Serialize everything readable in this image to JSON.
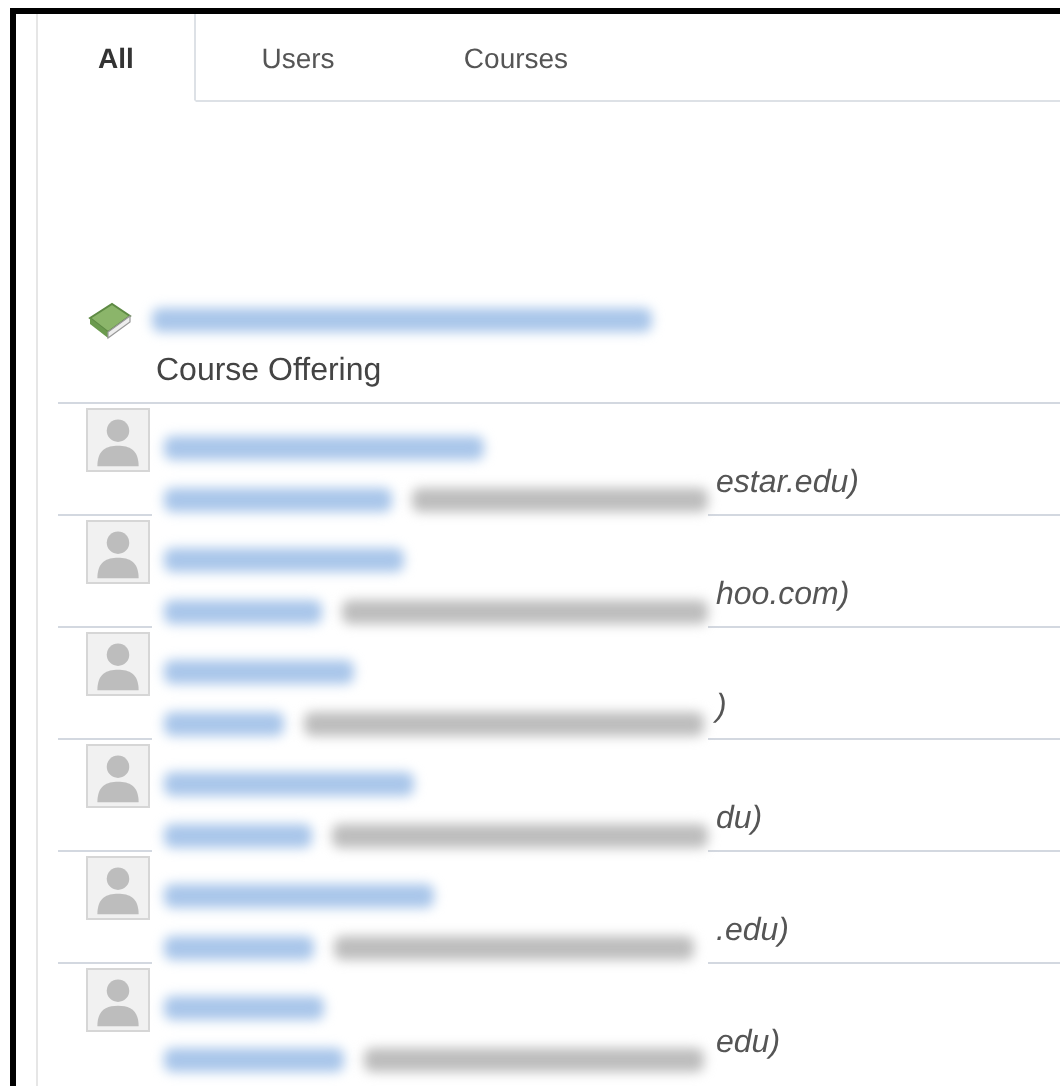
{
  "tabs": [
    {
      "label": "All",
      "selected": true
    },
    {
      "label": "Users",
      "selected": false
    },
    {
      "label": "Courses",
      "selected": false
    }
  ],
  "course": {
    "kind": "course",
    "type_label": "Course Offering"
  },
  "users": [
    {
      "email_visible": "estar.edu)"
    },
    {
      "email_visible": "hoo.com)"
    },
    {
      "email_visible": ")"
    },
    {
      "email_visible": "du)"
    },
    {
      "email_visible": ".edu)"
    },
    {
      "email_visible": "edu)"
    }
  ]
}
